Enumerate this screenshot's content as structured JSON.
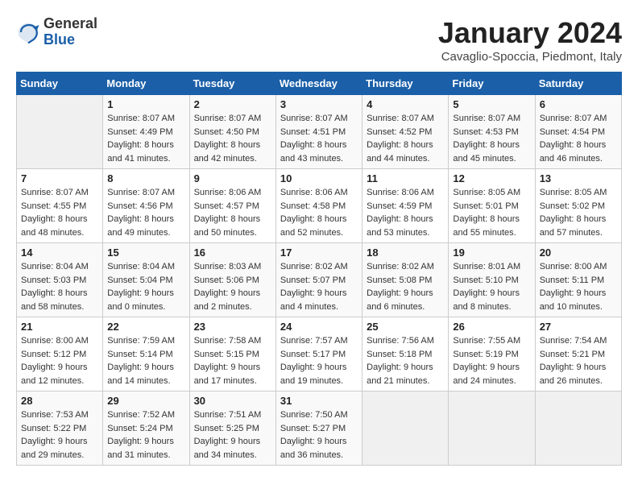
{
  "logo": {
    "text_general": "General",
    "text_blue": "Blue"
  },
  "title": "January 2024",
  "subtitle": "Cavaglio-Spoccia, Piedmont, Italy",
  "days_of_week": [
    "Sunday",
    "Monday",
    "Tuesday",
    "Wednesday",
    "Thursday",
    "Friday",
    "Saturday"
  ],
  "weeks": [
    [
      {
        "day": "",
        "sunrise": "",
        "sunset": "",
        "daylight": ""
      },
      {
        "day": "1",
        "sunrise": "Sunrise: 8:07 AM",
        "sunset": "Sunset: 4:49 PM",
        "daylight": "Daylight: 8 hours and 41 minutes."
      },
      {
        "day": "2",
        "sunrise": "Sunrise: 8:07 AM",
        "sunset": "Sunset: 4:50 PM",
        "daylight": "Daylight: 8 hours and 42 minutes."
      },
      {
        "day": "3",
        "sunrise": "Sunrise: 8:07 AM",
        "sunset": "Sunset: 4:51 PM",
        "daylight": "Daylight: 8 hours and 43 minutes."
      },
      {
        "day": "4",
        "sunrise": "Sunrise: 8:07 AM",
        "sunset": "Sunset: 4:52 PM",
        "daylight": "Daylight: 8 hours and 44 minutes."
      },
      {
        "day": "5",
        "sunrise": "Sunrise: 8:07 AM",
        "sunset": "Sunset: 4:53 PM",
        "daylight": "Daylight: 8 hours and 45 minutes."
      },
      {
        "day": "6",
        "sunrise": "Sunrise: 8:07 AM",
        "sunset": "Sunset: 4:54 PM",
        "daylight": "Daylight: 8 hours and 46 minutes."
      }
    ],
    [
      {
        "day": "7",
        "sunrise": "Sunrise: 8:07 AM",
        "sunset": "Sunset: 4:55 PM",
        "daylight": "Daylight: 8 hours and 48 minutes."
      },
      {
        "day": "8",
        "sunrise": "Sunrise: 8:07 AM",
        "sunset": "Sunset: 4:56 PM",
        "daylight": "Daylight: 8 hours and 49 minutes."
      },
      {
        "day": "9",
        "sunrise": "Sunrise: 8:06 AM",
        "sunset": "Sunset: 4:57 PM",
        "daylight": "Daylight: 8 hours and 50 minutes."
      },
      {
        "day": "10",
        "sunrise": "Sunrise: 8:06 AM",
        "sunset": "Sunset: 4:58 PM",
        "daylight": "Daylight: 8 hours and 52 minutes."
      },
      {
        "day": "11",
        "sunrise": "Sunrise: 8:06 AM",
        "sunset": "Sunset: 4:59 PM",
        "daylight": "Daylight: 8 hours and 53 minutes."
      },
      {
        "day": "12",
        "sunrise": "Sunrise: 8:05 AM",
        "sunset": "Sunset: 5:01 PM",
        "daylight": "Daylight: 8 hours and 55 minutes."
      },
      {
        "day": "13",
        "sunrise": "Sunrise: 8:05 AM",
        "sunset": "Sunset: 5:02 PM",
        "daylight": "Daylight: 8 hours and 57 minutes."
      }
    ],
    [
      {
        "day": "14",
        "sunrise": "Sunrise: 8:04 AM",
        "sunset": "Sunset: 5:03 PM",
        "daylight": "Daylight: 8 hours and 58 minutes."
      },
      {
        "day": "15",
        "sunrise": "Sunrise: 8:04 AM",
        "sunset": "Sunset: 5:04 PM",
        "daylight": "Daylight: 9 hours and 0 minutes."
      },
      {
        "day": "16",
        "sunrise": "Sunrise: 8:03 AM",
        "sunset": "Sunset: 5:06 PM",
        "daylight": "Daylight: 9 hours and 2 minutes."
      },
      {
        "day": "17",
        "sunrise": "Sunrise: 8:02 AM",
        "sunset": "Sunset: 5:07 PM",
        "daylight": "Daylight: 9 hours and 4 minutes."
      },
      {
        "day": "18",
        "sunrise": "Sunrise: 8:02 AM",
        "sunset": "Sunset: 5:08 PM",
        "daylight": "Daylight: 9 hours and 6 minutes."
      },
      {
        "day": "19",
        "sunrise": "Sunrise: 8:01 AM",
        "sunset": "Sunset: 5:10 PM",
        "daylight": "Daylight: 9 hours and 8 minutes."
      },
      {
        "day": "20",
        "sunrise": "Sunrise: 8:00 AM",
        "sunset": "Sunset: 5:11 PM",
        "daylight": "Daylight: 9 hours and 10 minutes."
      }
    ],
    [
      {
        "day": "21",
        "sunrise": "Sunrise: 8:00 AM",
        "sunset": "Sunset: 5:12 PM",
        "daylight": "Daylight: 9 hours and 12 minutes."
      },
      {
        "day": "22",
        "sunrise": "Sunrise: 7:59 AM",
        "sunset": "Sunset: 5:14 PM",
        "daylight": "Daylight: 9 hours and 14 minutes."
      },
      {
        "day": "23",
        "sunrise": "Sunrise: 7:58 AM",
        "sunset": "Sunset: 5:15 PM",
        "daylight": "Daylight: 9 hours and 17 minutes."
      },
      {
        "day": "24",
        "sunrise": "Sunrise: 7:57 AM",
        "sunset": "Sunset: 5:17 PM",
        "daylight": "Daylight: 9 hours and 19 minutes."
      },
      {
        "day": "25",
        "sunrise": "Sunrise: 7:56 AM",
        "sunset": "Sunset: 5:18 PM",
        "daylight": "Daylight: 9 hours and 21 minutes."
      },
      {
        "day": "26",
        "sunrise": "Sunrise: 7:55 AM",
        "sunset": "Sunset: 5:19 PM",
        "daylight": "Daylight: 9 hours and 24 minutes."
      },
      {
        "day": "27",
        "sunrise": "Sunrise: 7:54 AM",
        "sunset": "Sunset: 5:21 PM",
        "daylight": "Daylight: 9 hours and 26 minutes."
      }
    ],
    [
      {
        "day": "28",
        "sunrise": "Sunrise: 7:53 AM",
        "sunset": "Sunset: 5:22 PM",
        "daylight": "Daylight: 9 hours and 29 minutes."
      },
      {
        "day": "29",
        "sunrise": "Sunrise: 7:52 AM",
        "sunset": "Sunset: 5:24 PM",
        "daylight": "Daylight: 9 hours and 31 minutes."
      },
      {
        "day": "30",
        "sunrise": "Sunrise: 7:51 AM",
        "sunset": "Sunset: 5:25 PM",
        "daylight": "Daylight: 9 hours and 34 minutes."
      },
      {
        "day": "31",
        "sunrise": "Sunrise: 7:50 AM",
        "sunset": "Sunset: 5:27 PM",
        "daylight": "Daylight: 9 hours and 36 minutes."
      },
      {
        "day": "",
        "sunrise": "",
        "sunset": "",
        "daylight": ""
      },
      {
        "day": "",
        "sunrise": "",
        "sunset": "",
        "daylight": ""
      },
      {
        "day": "",
        "sunrise": "",
        "sunset": "",
        "daylight": ""
      }
    ]
  ]
}
